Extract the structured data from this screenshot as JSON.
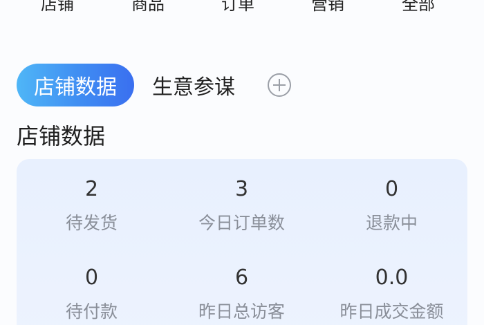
{
  "top_nav": {
    "items": [
      "店铺",
      "商品",
      "订单",
      "营销",
      "全部"
    ]
  },
  "tabs": {
    "active_label": "店铺数据",
    "second_label": "生意参谋",
    "add_icon": "plus-circle-icon"
  },
  "section": {
    "title": "店铺数据"
  },
  "stats": [
    {
      "value": "2",
      "label": "待发货"
    },
    {
      "value": "3",
      "label": "今日订单数"
    },
    {
      "value": "0",
      "label": "退款中"
    },
    {
      "value": "0",
      "label": "待付款"
    },
    {
      "value": "6",
      "label": "昨日总访客"
    },
    {
      "value": "0.0",
      "label": "昨日成交金额"
    }
  ],
  "colors": {
    "accent_start": "#4fb6f7",
    "accent_end": "#3a6ff0",
    "card_bg": "#e8f0fe",
    "label_gray": "#8a8f99"
  }
}
